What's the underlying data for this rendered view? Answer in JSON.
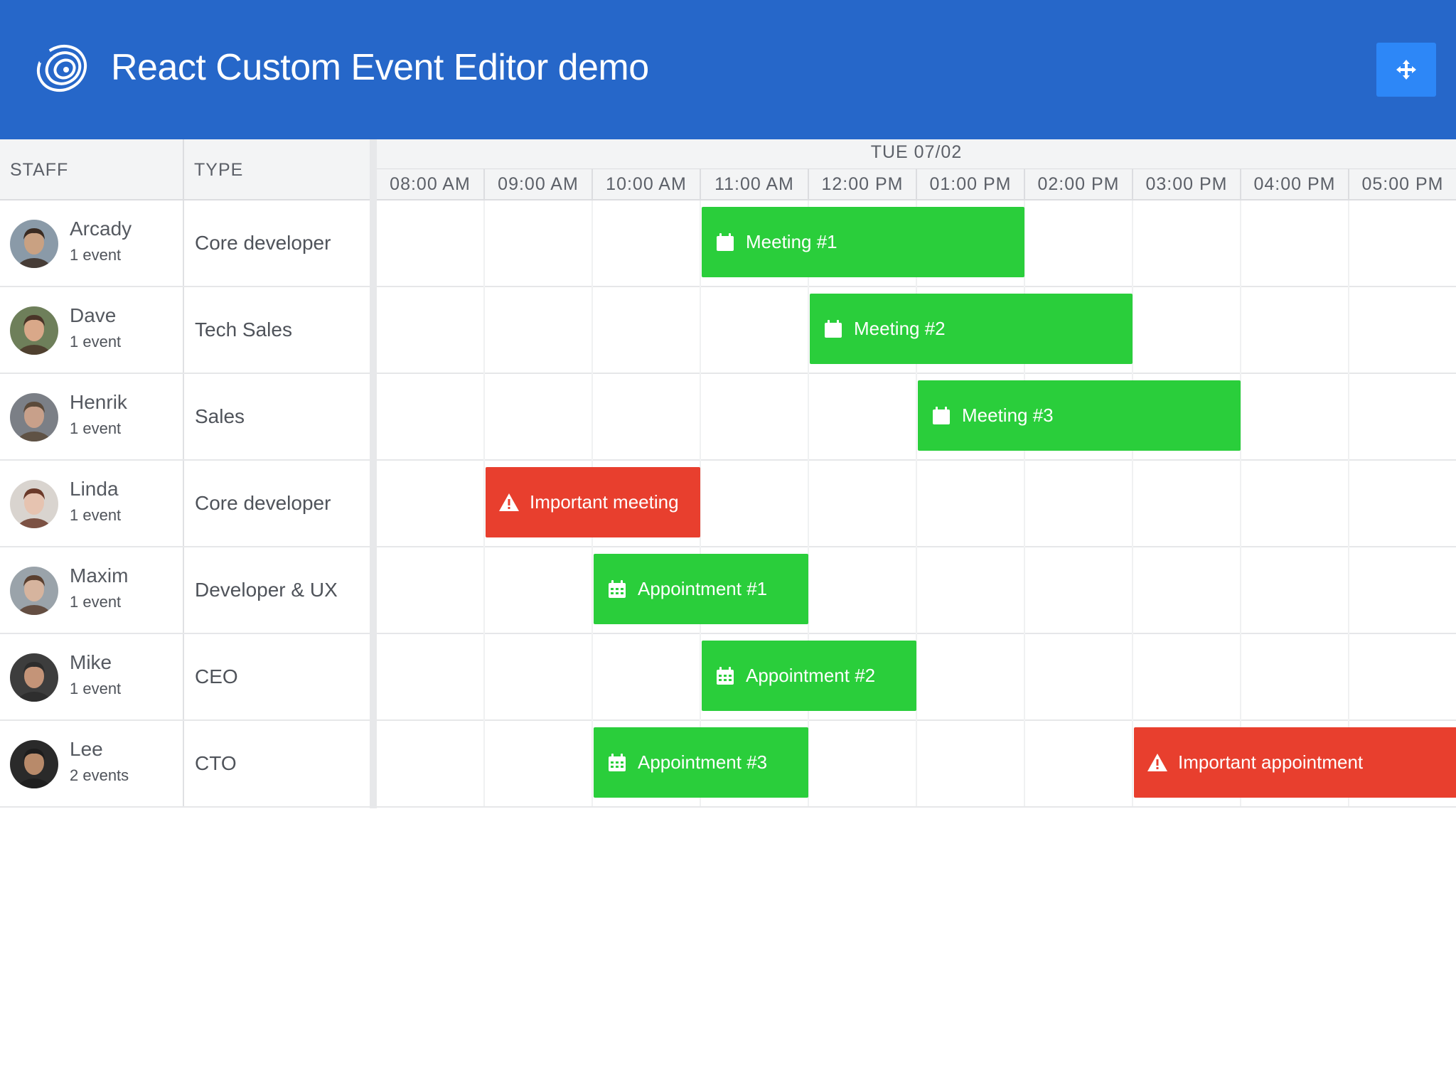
{
  "header": {
    "title": "React Custom Event Editor demo",
    "logo_icon": "spiral-logo-icon",
    "fullscreen_icon": "move-arrows-icon",
    "background": "#2667c9",
    "button_color": "#2d87f7"
  },
  "columns": {
    "staff": "STAFF",
    "type": "TYPE"
  },
  "timeline": {
    "date": "TUE 07/02",
    "hours": [
      "08:00 AM",
      "09:00 AM",
      "10:00 AM",
      "11:00 AM",
      "12:00 PM",
      "01:00 PM",
      "02:00 PM",
      "03:00 PM",
      "04:00 PM",
      "05:00 PM"
    ]
  },
  "colors": {
    "event_green": "#2ace3b",
    "event_red": "#e83f2e"
  },
  "resources": [
    {
      "name": "Arcady",
      "count": "1 event",
      "type": "Core developer",
      "avatar_skin": "#c9a182",
      "avatar_hair": "#3a2b22",
      "avatar_bg": "#8a9aa8"
    },
    {
      "name": "Dave",
      "count": "1 event",
      "type": "Tech Sales",
      "avatar_skin": "#d9a889",
      "avatar_hair": "#4a3528",
      "avatar_bg": "#6e7f5a"
    },
    {
      "name": "Henrik",
      "count": "1 event",
      "type": "Sales",
      "avatar_skin": "#c8a08a",
      "avatar_hair": "#5b4a3a",
      "avatar_bg": "#7b7f86"
    },
    {
      "name": "Linda",
      "count": "1 event",
      "type": "Core developer",
      "avatar_skin": "#e6c3b0",
      "avatar_hair": "#6b3a2a",
      "avatar_bg": "#d9d4cf"
    },
    {
      "name": "Maxim",
      "count": "1 event",
      "type": "Developer & UX",
      "avatar_skin": "#d6b49e",
      "avatar_hair": "#5a4030",
      "avatar_bg": "#9aa3aa"
    },
    {
      "name": "Mike",
      "count": "1 event",
      "type": "CEO",
      "avatar_skin": "#c49478",
      "avatar_hair": "#2c2c2c",
      "avatar_bg": "#3d3d3d"
    },
    {
      "name": "Lee",
      "count": "2 events",
      "type": "CTO",
      "avatar_skin": "#b88a6a",
      "avatar_hair": "#1d1d1d",
      "avatar_bg": "#2a2a2a"
    }
  ],
  "events": [
    {
      "row": 0,
      "start": "11:00",
      "end": "14:00",
      "label": "Meeting #1",
      "color": "green",
      "icon": "calendar-icon"
    },
    {
      "row": 1,
      "start": "12:00",
      "end": "15:00",
      "label": "Meeting #2",
      "color": "green",
      "icon": "calendar-icon"
    },
    {
      "row": 2,
      "start": "13:00",
      "end": "16:00",
      "label": "Meeting #3",
      "color": "green",
      "icon": "calendar-icon"
    },
    {
      "row": 3,
      "start": "09:00",
      "end": "11:00",
      "label": "Important meeting",
      "color": "red",
      "icon": "warning-icon"
    },
    {
      "row": 4,
      "start": "10:00",
      "end": "12:00",
      "label": "Appointment #1",
      "color": "green",
      "icon": "calendar-grid-icon"
    },
    {
      "row": 5,
      "start": "11:00",
      "end": "13:00",
      "label": "Appointment #2",
      "color": "green",
      "icon": "calendar-grid-icon"
    },
    {
      "row": 6,
      "start": "10:00",
      "end": "12:00",
      "label": "Appointment #3",
      "color": "green",
      "icon": "calendar-grid-icon"
    },
    {
      "row": 6,
      "start": "15:00",
      "end": "18:00",
      "label": "Important appointment",
      "color": "red",
      "icon": "warning-icon"
    }
  ]
}
